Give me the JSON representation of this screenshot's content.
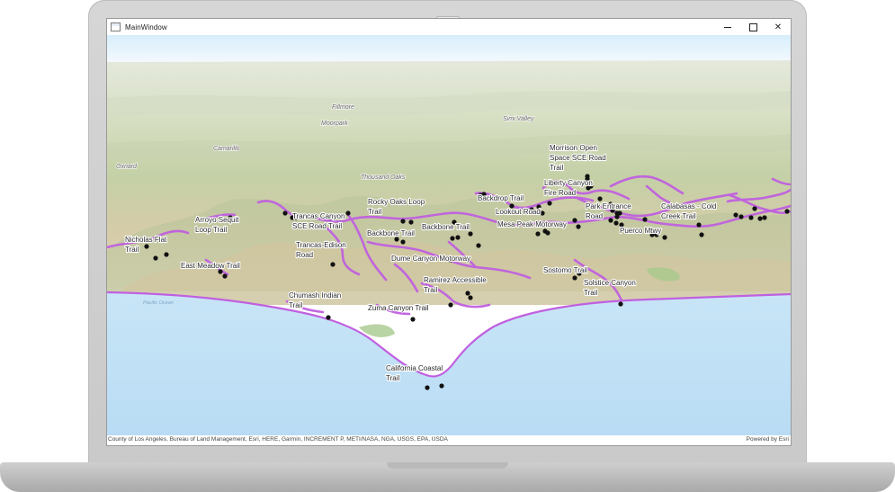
{
  "window": {
    "title": "MainWindow",
    "controls": {
      "minimize": "minimize",
      "maximize": "maximize",
      "close": "close"
    }
  },
  "map": {
    "basemap_towns": [
      "Fillmore",
      "Moorpark",
      "Simi Valley",
      "Thousand Oaks",
      "Oxnard",
      "Camarillo"
    ],
    "ocean_label": "Pacific Ocean",
    "trail_labels": [
      {
        "id": "morrison",
        "lines": [
          "Morrison Open",
          "Space SCE Road",
          "Trail"
        ]
      },
      {
        "id": "liberty",
        "lines": [
          "Liberty Canyon",
          "Fire Road"
        ]
      },
      {
        "id": "backdrop",
        "lines": [
          "Backdrop Trail"
        ]
      },
      {
        "id": "rocky-oaks",
        "lines": [
          "Rocky Oaks Loop",
          "Trail"
        ]
      },
      {
        "id": "lookout",
        "lines": [
          "Lookout Road"
        ]
      },
      {
        "id": "park-entrance",
        "lines": [
          "Park Entrance",
          "Road"
        ]
      },
      {
        "id": "calabasas-cold-creek",
        "lines": [
          "Calabasas - Cold",
          "Creek Trail"
        ]
      },
      {
        "id": "trancas-canyon",
        "lines": [
          "Trancas Canyon",
          "SCE Road Trail"
        ]
      },
      {
        "id": "arroyo-sequit",
        "lines": [
          "Arroyo Sequit",
          "Loop Trail"
        ]
      },
      {
        "id": "backbone-1",
        "lines": [
          "Backbone Trail"
        ]
      },
      {
        "id": "backbone-2",
        "lines": [
          "Backbone Trail"
        ]
      },
      {
        "id": "mesa-peak",
        "lines": [
          "Mesa Peak Motorway"
        ]
      },
      {
        "id": "puerco-mtwy",
        "lines": [
          "Puerco Mtwy"
        ]
      },
      {
        "id": "nicholas-flat",
        "lines": [
          "Nicholas Flat",
          "Trail"
        ]
      },
      {
        "id": "trancas-edison",
        "lines": [
          "Trancas-Edison",
          "Road"
        ]
      },
      {
        "id": "east-meadow",
        "lines": [
          "East Meadow Trail"
        ]
      },
      {
        "id": "dume-canyon",
        "lines": [
          "Dume Canyon Motorway"
        ]
      },
      {
        "id": "sostomo",
        "lines": [
          "Sostomo Trail"
        ]
      },
      {
        "id": "solstice-canyon",
        "lines": [
          "Solstice Canyon",
          "Trail"
        ]
      },
      {
        "id": "ramirez",
        "lines": [
          "Ramirez Accessible",
          "Trail"
        ]
      },
      {
        "id": "chumash",
        "lines": [
          "Chumash Indian",
          "Trail"
        ]
      },
      {
        "id": "zuma-canyon",
        "lines": [
          "Zuma Canyon Trail"
        ]
      },
      {
        "id": "california-coastal",
        "lines": [
          "California Coastal",
          "Trail"
        ]
      }
    ],
    "attribution": "County of Los Angeles, Bureau of Land Management, Esri, HERE, Garmin, INCREMENT P, METI/NASA, NGA, USGS, EPA, USDA",
    "powered_by": "Powered by Esri",
    "colors": {
      "sky": "#e6f5fd",
      "ocean": "#bfe0f6",
      "land_far": "#dfe6d4",
      "land_mid": "#c9d4ae",
      "land_near": "#dccfae",
      "trail": "#c060e0",
      "trailhead": "#111111"
    }
  }
}
